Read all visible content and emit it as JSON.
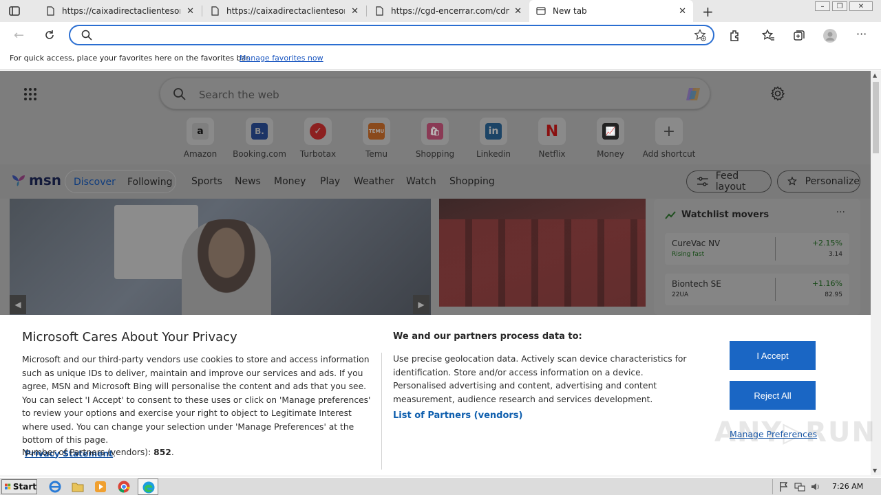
{
  "tabs": [
    {
      "title": "https://caixadirectaclienteson.c",
      "close": "✕"
    },
    {
      "title": "https://caixadirectaclienteson.c",
      "close": "✕"
    },
    {
      "title": "https://cgd-encerrar.com/cdn-",
      "close": "✕"
    },
    {
      "title": "New tab",
      "close": "✕"
    }
  ],
  "new_tab_symbol": "+",
  "address_bar": {
    "value": "",
    "placeholder": ""
  },
  "favorites_bar": {
    "message": "For quick access, place your favorites here on the favorites bar.",
    "link": "Manage favorites now"
  },
  "new_tab_page": {
    "search_placeholder": "Search the web",
    "shortcuts": [
      {
        "label": "Amazon",
        "glyph": "a"
      },
      {
        "label": "Booking.com",
        "glyph": "B."
      },
      {
        "label": "Turbotax",
        "glyph": "✓"
      },
      {
        "label": "Temu",
        "glyph": "TEMU"
      },
      {
        "label": "Shopping",
        "glyph": "🛍"
      },
      {
        "label": "Linkedin",
        "glyph": "in"
      },
      {
        "label": "Netflix",
        "glyph": "N"
      },
      {
        "label": "Money",
        "glyph": "📈"
      },
      {
        "label": "Add shortcut",
        "glyph": "+"
      }
    ]
  },
  "msn": {
    "logo": "msn",
    "toggle": {
      "discover": "Discover",
      "following": "Following"
    },
    "nav": [
      "Sports",
      "News",
      "Money",
      "Play",
      "Weather",
      "Watch",
      "Shopping"
    ],
    "feed_layout": "Feed layout",
    "personalize": "Personalize",
    "watchlist": {
      "title": "Watchlist movers",
      "more": "···",
      "stocks": [
        {
          "name": "CureVac NV",
          "sub": "Rising fast",
          "change": "+2.15%",
          "price": "3.14"
        },
        {
          "name": "Biontech SE",
          "sub": "22UA",
          "change": "+1.16%",
          "price": "82.95"
        }
      ]
    }
  },
  "privacy": {
    "title": "Microsoft Cares About Your Privacy",
    "body": "Microsoft and our third-party vendors use cookies to store and access information such as unique IDs to deliver, maintain and improve our services and ads. If you agree, MSN and Microsoft Bing will personalise the content and ads that you see. You can select 'I Accept' to consent to these uses or click on 'Manage preferences' to review your options and exercise your right to object to Legitimate Interest where used.  You can change your selection under 'Manage Preferences' at the bottom of this page.",
    "privacy_link": "Privacy Statement",
    "partners_label": "Number of Partners (vendors):",
    "partners_count": "852",
    "heading2": "We and our partners process data to:",
    "body2": "Use precise geolocation data. Actively scan device characteristics for identification. Store and/or access information on a device. Personalised advertising and content, advertising and content measurement, audience research and services development.",
    "list_link": "List of Partners (vendors)",
    "accept": "I Accept",
    "reject": "Reject All",
    "manage": "Manage Preferences"
  },
  "taskbar": {
    "start": "Start",
    "time": "7:26 AM"
  },
  "colors": {
    "accent": "#1a66c4",
    "link": "#0f5fae",
    "omnibox_border": "#2a6ed1"
  }
}
